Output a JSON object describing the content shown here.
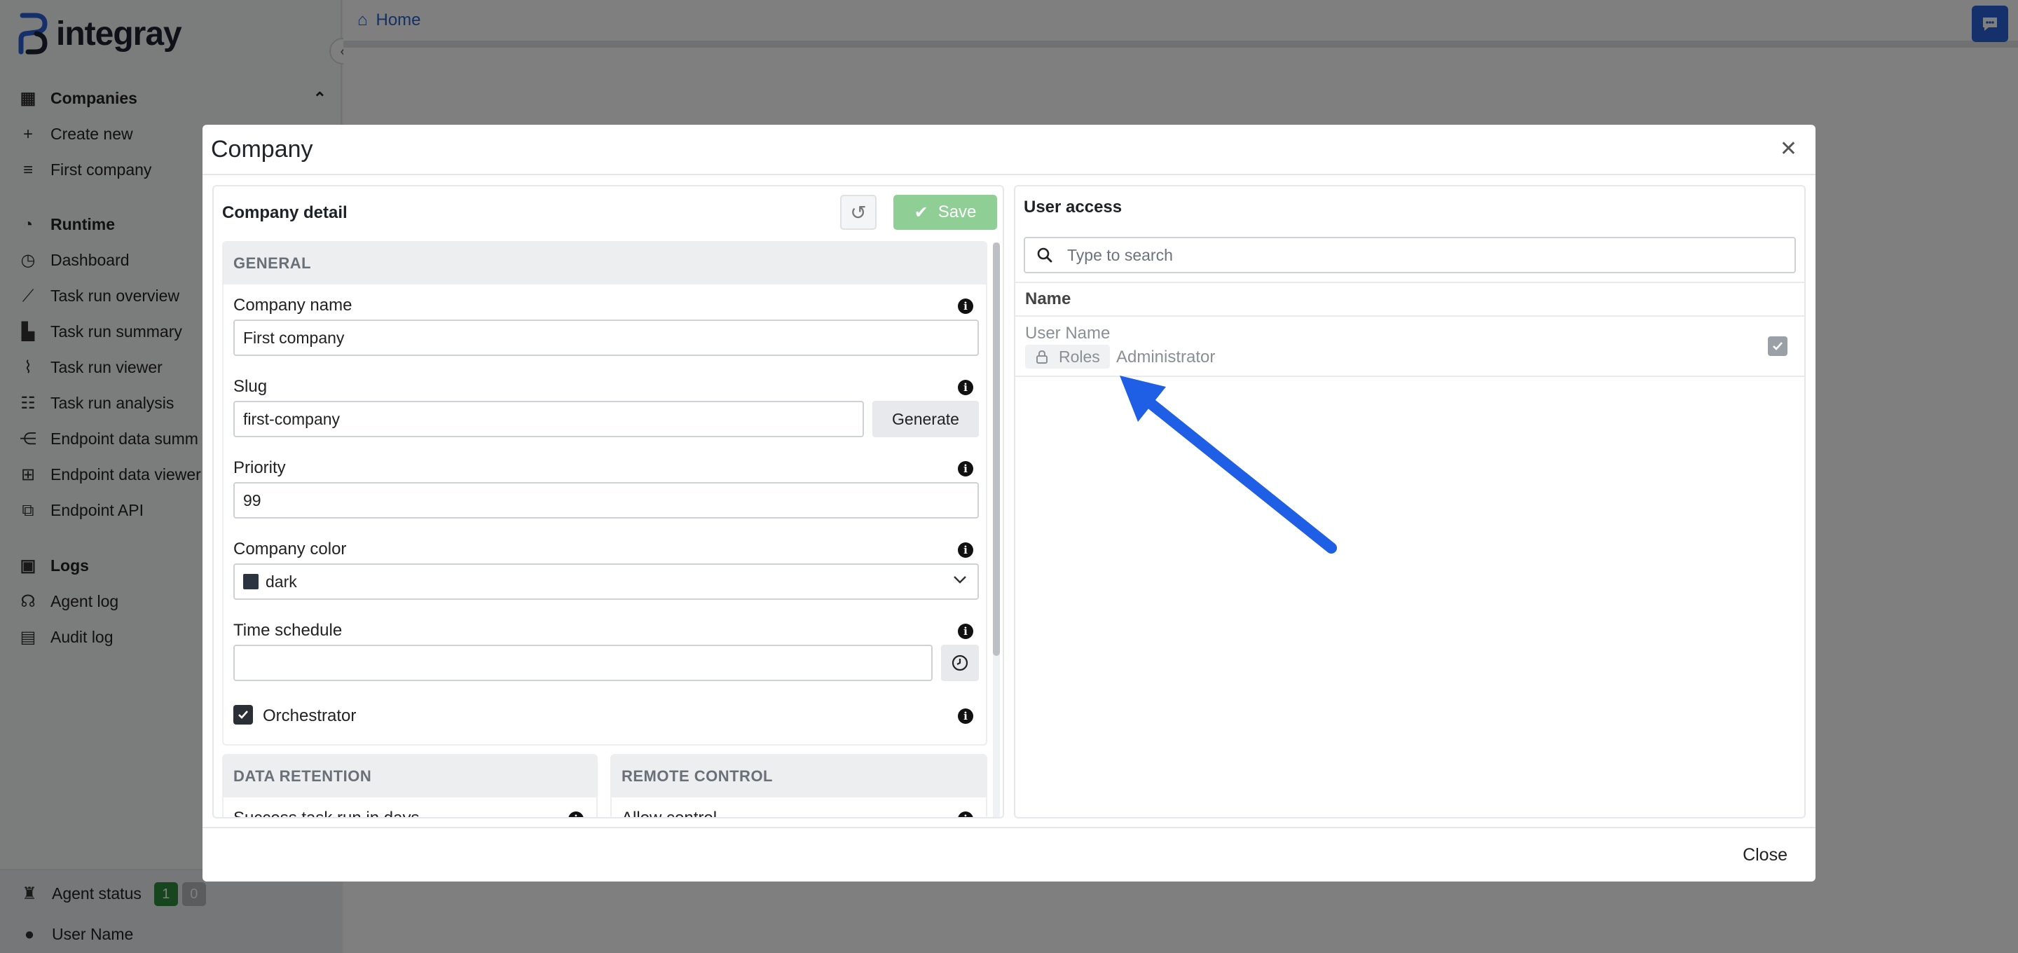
{
  "app": {
    "logo_text": "integray"
  },
  "breadcrumb": {
    "home": "Home"
  },
  "sidebar": {
    "companies": {
      "label": "Companies",
      "items": [
        "Create new",
        "First company"
      ]
    },
    "runtime": {
      "label": "Runtime",
      "items": [
        "Dashboard",
        "Task run overview",
        "Task run summary",
        "Task run viewer",
        "Task run analysis",
        "Endpoint data summ",
        "Endpoint data viewer",
        "Endpoint API"
      ]
    },
    "logs": {
      "label": "Logs",
      "items": [
        "Agent log",
        "Audit log"
      ]
    },
    "agent_status": {
      "label": "Agent status",
      "online": "1",
      "offline": "0"
    },
    "user": "User Name"
  },
  "modal": {
    "title": "Company",
    "close_label": "Close",
    "detail": {
      "title": "Company detail",
      "save_label": "Save",
      "general_heading": "GENERAL",
      "company_name": {
        "label": "Company name",
        "value": "First  company"
      },
      "slug": {
        "label": "Slug",
        "value": "first-company",
        "generate_label": "Generate"
      },
      "priority": {
        "label": "Priority",
        "value": "99"
      },
      "company_color": {
        "label": "Company color",
        "value": "dark",
        "swatch": "#2b3440"
      },
      "time_schedule": {
        "label": "Time schedule",
        "value": ""
      },
      "orchestrator": {
        "label": "Orchestrator",
        "checked": true
      },
      "data_retention_heading": "DATA RETENTION",
      "data_retention_first_label": "Success task run in days",
      "remote_control_heading": "REMOTE CONTROL",
      "remote_control_first_label": "Allow control"
    },
    "user_access": {
      "title": "User access",
      "search_placeholder": "Type to search",
      "column_name": "Name",
      "rows": [
        {
          "name": "User Name",
          "roles_label": "Roles",
          "role": "Administrator",
          "checked": true
        }
      ]
    }
  },
  "colors": {
    "accent": "#2b62d9",
    "save_button": "#8fcf96",
    "arrow": "#1f5fe6"
  }
}
